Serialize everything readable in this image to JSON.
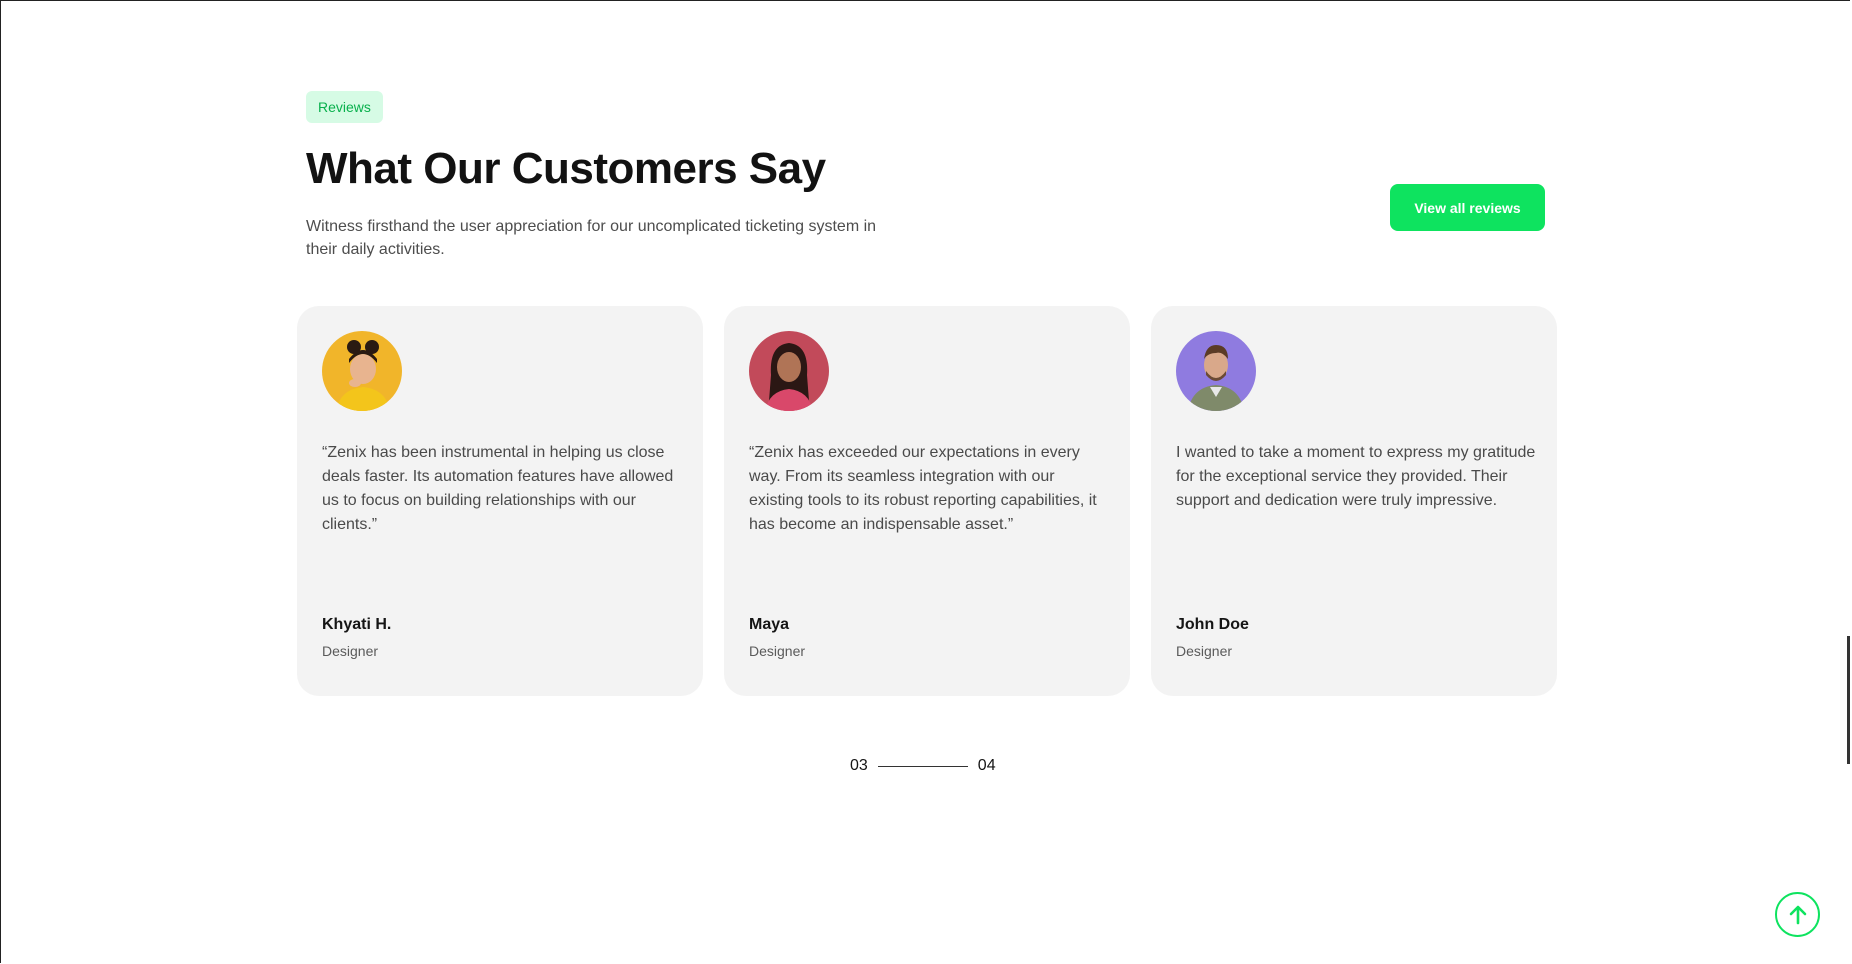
{
  "section": {
    "tag": "Reviews",
    "title": "What Our Customers Say",
    "subtitle": "Witness firsthand the user appreciation for our uncomplicated ticketing system in their daily activities.",
    "view_all_label": "View all reviews"
  },
  "reviews": [
    {
      "quote": "“Zenix has been instrumental in helping us close deals faster. Its automation features have allowed us to focus on building relationships with our clients.”",
      "name": "Khyati H.",
      "role": "Designer",
      "avatar_bg": "#f1b52a"
    },
    {
      "quote": "“Zenix has exceeded our expectations in every way. From its seamless integration with our existing tools to its robust reporting capabilities, it has become an indispensable asset.”",
      "name": "Maya",
      "role": "Designer",
      "avatar_bg": "#c24a5a"
    },
    {
      "quote": "I wanted to take a moment to express my gratitude for the exceptional service they provided. Their support and dedication were truly impressive.",
      "name": "John Doe",
      "role": "Designer",
      "avatar_bg": "#8f7be0"
    }
  ],
  "pager": {
    "current": "03",
    "total": "04"
  },
  "icons": {
    "scroll_top": "arrow-up-icon"
  },
  "colors": {
    "accent": "#0ee35f",
    "tag_bg": "#d6fbe5",
    "card_bg": "#f3f3f3"
  }
}
